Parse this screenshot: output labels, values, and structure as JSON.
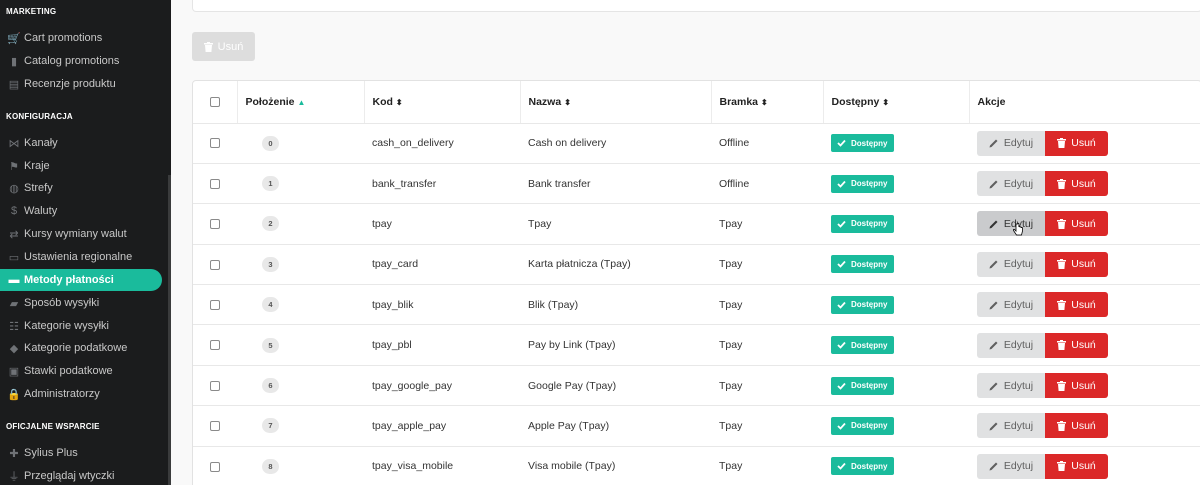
{
  "sidebar": {
    "sections": [
      {
        "title": "MARKETING",
        "items": [
          {
            "label": "Cart promotions",
            "icon": "cart-icon"
          },
          {
            "label": "Catalog promotions",
            "icon": "bookmark-icon"
          },
          {
            "label": "Recenzje produktu",
            "icon": "newspaper-icon"
          }
        ]
      },
      {
        "title": "KONFIGURACJA",
        "items": [
          {
            "label": "Kanały",
            "icon": "share-icon"
          },
          {
            "label": "Kraje",
            "icon": "flag-icon"
          },
          {
            "label": "Strefy",
            "icon": "globe-icon"
          },
          {
            "label": "Waluty",
            "icon": "dollar-icon"
          },
          {
            "label": "Kursy wymiany walut",
            "icon": "exchange-icon"
          },
          {
            "label": "Ustawienia regionalne",
            "icon": "translate-icon"
          },
          {
            "label": "Metody płatności",
            "icon": "credit-card-icon",
            "active": true
          },
          {
            "label": "Sposób wysyłki",
            "icon": "truck-icon"
          },
          {
            "label": "Kategorie wysyłki",
            "icon": "grid-icon"
          },
          {
            "label": "Kategorie podatkowe",
            "icon": "tags-icon"
          },
          {
            "label": "Stawki podatkowe",
            "icon": "money-icon"
          },
          {
            "label": "Administratorzy",
            "icon": "lock-icon"
          }
        ]
      },
      {
        "title": "OFICJALNE WSPARCIE",
        "items": [
          {
            "label": "Sylius Plus",
            "icon": "plus-icon"
          },
          {
            "label": "Przeglądaj wtyczki",
            "icon": "plug-icon"
          }
        ]
      }
    ]
  },
  "toolbar": {
    "bulk_delete_label": "Usuń"
  },
  "table": {
    "headers": {
      "position": "Położenie",
      "code": "Kod",
      "name": "Nazwa",
      "gateway": "Bramka",
      "enabled": "Dostępny",
      "actions": "Akcje"
    },
    "rows": [
      {
        "position": "0",
        "code": "cash_on_delivery",
        "name": "Cash on delivery",
        "gateway": "Offline",
        "enabled": "Dostępny"
      },
      {
        "position": "1",
        "code": "bank_transfer",
        "name": "Bank transfer",
        "gateway": "Offline",
        "enabled": "Dostępny"
      },
      {
        "position": "2",
        "code": "tpay",
        "name": "Tpay",
        "gateway": "Tpay",
        "enabled": "Dostępny"
      },
      {
        "position": "3",
        "code": "tpay_card",
        "name": "Karta płatnicza (Tpay)",
        "gateway": "Tpay",
        "enabled": "Dostępny"
      },
      {
        "position": "4",
        "code": "tpay_blik",
        "name": "Blik (Tpay)",
        "gateway": "Tpay",
        "enabled": "Dostępny"
      },
      {
        "position": "5",
        "code": "tpay_pbl",
        "name": "Pay by Link (Tpay)",
        "gateway": "Tpay",
        "enabled": "Dostępny"
      },
      {
        "position": "6",
        "code": "tpay_google_pay",
        "name": "Google Pay (Tpay)",
        "gateway": "Tpay",
        "enabled": "Dostępny"
      },
      {
        "position": "7",
        "code": "tpay_apple_pay",
        "name": "Apple Pay (Tpay)",
        "gateway": "Tpay",
        "enabled": "Dostępny"
      },
      {
        "position": "8",
        "code": "tpay_visa_mobile",
        "name": "Visa mobile (Tpay)",
        "gateway": "Tpay",
        "enabled": "Dostępny"
      }
    ],
    "edit_label": "Edytuj",
    "delete_label": "Usuń"
  },
  "colors": {
    "accent": "#1abb9c",
    "danger": "#db2828",
    "sidebar_bg": "#1b1c1d"
  }
}
